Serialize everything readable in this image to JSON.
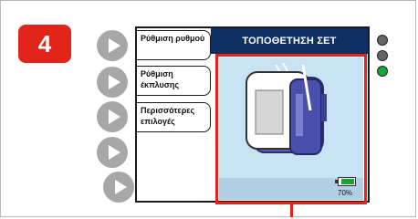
{
  "step": {
    "number": "4"
  },
  "menu": {
    "items": [
      {
        "label": "Ρύθμιση ρυθμού"
      },
      {
        "label": "Ρύθμιση έκπλυσης"
      },
      {
        "label": "Περισσότερες επιλογές"
      }
    ]
  },
  "screen": {
    "title": "ΤΟΠΟΘΕΤΗΣΗ ΣΕΤ",
    "battery_percent": "70%"
  },
  "side_buttons": [
    {
      "icon": "play-icon"
    },
    {
      "icon": "play-icon"
    },
    {
      "icon": "play-icon"
    },
    {
      "icon": "play-icon"
    },
    {
      "icon": "play-icon"
    }
  ],
  "indicator_lights": [
    {
      "state": "off",
      "color": "#666666"
    },
    {
      "state": "off",
      "color": "#666666"
    },
    {
      "state": "on",
      "color": "#19a33a"
    }
  ],
  "colors": {
    "accent": "#e1251b",
    "title_bar": "#0d2f63",
    "screen_background": "#c7e3f3"
  }
}
